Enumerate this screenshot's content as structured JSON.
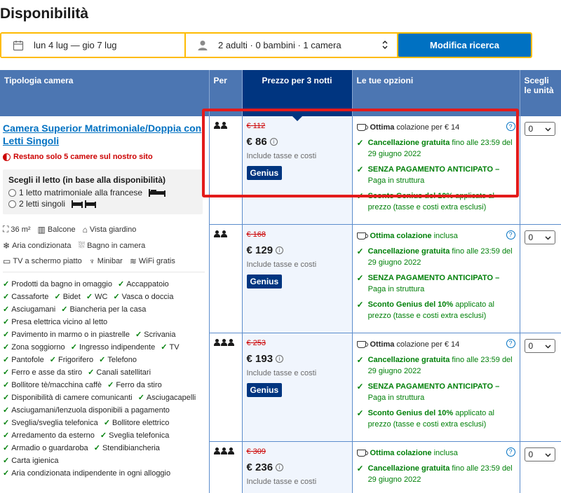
{
  "page": {
    "title": "Disponibilità"
  },
  "search": {
    "dates": "lun 4 lug — gio 7 lug",
    "guests": "2 adulti · 0 bambini · 1 camera",
    "button": "Modifica ricerca"
  },
  "table": {
    "headers": {
      "type": "Tipologia camera",
      "per": "Per",
      "price": "Prezzo per 3 notti",
      "options": "Le tue opzioni",
      "qty": "Scegli le unità"
    }
  },
  "room": {
    "name": "Camera Superior Matrimoniale/Doppia con Letti Singoli",
    "scarcity": "Restano solo 5 camere sul nostro sito",
    "bed_title": "Scegli il letto (in base alla disponibilità)",
    "bed_option_1": "1 letto matrimoniale alla francese",
    "bed_option_2": "2 letti singoli",
    "facilities": [
      "36 m²",
      "Balcone",
      "Vista giardino",
      "Aria condizionata",
      "Bagno in camera",
      "TV a schermo piatto",
      "Minibar",
      "WiFi gratis"
    ],
    "amenities": [
      "Prodotti da bagno in omaggio",
      "Accappatoio",
      "Cassaforte",
      "Bidet",
      "WC",
      "Vasca o doccia",
      "Asciugamani",
      "Biancheria per la casa",
      "Presa elettrica vicino al letto",
      "Pavimento in marmo o in piastrelle",
      "Scrivania",
      "Zona soggiorno",
      "Ingresso indipendente",
      "TV",
      "Pantofole",
      "Frigorifero",
      "Telefono",
      "Ferro e asse da stiro",
      "Canali satellitari",
      "Bollitore tè/macchina caffè",
      "Ferro da stiro",
      "Disponibilità di camere comunicanti",
      "Asciugacapelli",
      "Asciugamani/lenzuola disponibili a pagamento",
      "Sveglia/sveglia telefonica",
      "Bollitore elettrico",
      "Arredamento da esterno",
      "Sveglia telefonica",
      "Armadio o guardaroba",
      "Stendibiancheria",
      "Carta igienica",
      "Aria condizionata indipendente in ogni alloggio"
    ]
  },
  "offers": [
    {
      "persons": 2,
      "old_price": "€ 112",
      "price": "€ 86",
      "taxes": "Include tasse e costi",
      "genius": "Genius",
      "breakfast_bold": "Ottima",
      "breakfast_rest": " colazione per € 14",
      "cancel_bold": "Cancellazione gratuita",
      "cancel_rest": " fino alle 23:59 del 29 giugno 2022",
      "prepay_bold": "SENZA PAGAMENTO ANTICIPATO –",
      "prepay_rest": " Paga in struttura",
      "discount_bold": "Sconto Genius del 10%",
      "discount_rest": " applicato al prezzo (tasse e costi extra esclusi)",
      "qty": "0"
    },
    {
      "persons": 2,
      "old_price": "€ 168",
      "price": "€ 129",
      "taxes": "Include tasse e costi",
      "genius": "Genius",
      "breakfast_bold": "Ottima colazione",
      "breakfast_rest": " inclusa",
      "cancel_bold": "Cancellazione gratuita",
      "cancel_rest": " fino alle 23:59 del 29 giugno 2022",
      "prepay_bold": "SENZA PAGAMENTO ANTICIPATO –",
      "prepay_rest": " Paga in struttura",
      "discount_bold": "Sconto Genius del 10%",
      "discount_rest": " applicato al prezzo (tasse e costi extra esclusi)",
      "qty": "0"
    },
    {
      "persons": 3,
      "old_price": "€ 253",
      "price": "€ 193",
      "taxes": "Include tasse e costi",
      "genius": "Genius",
      "breakfast_bold": "Ottima",
      "breakfast_rest": " colazione per € 14",
      "cancel_bold": "Cancellazione gratuita",
      "cancel_rest": " fino alle 23:59 del 29 giugno 2022",
      "prepay_bold": "SENZA PAGAMENTO ANTICIPATO –",
      "prepay_rest": " Paga in struttura",
      "discount_bold": "Sconto Genius del 10%",
      "discount_rest": " applicato al prezzo (tasse e costi extra esclusi)",
      "qty": "0"
    },
    {
      "persons": 3,
      "old_price": "€ 309",
      "price": "€ 236",
      "taxes": "Include tasse e costi",
      "breakfast_bold": "Ottima colazione",
      "breakfast_rest": " inclusa",
      "cancel_bold": "Cancellazione gratuita",
      "cancel_rest": " fino alle 23:59 del 29 giugno 2022",
      "qty": "0"
    }
  ]
}
